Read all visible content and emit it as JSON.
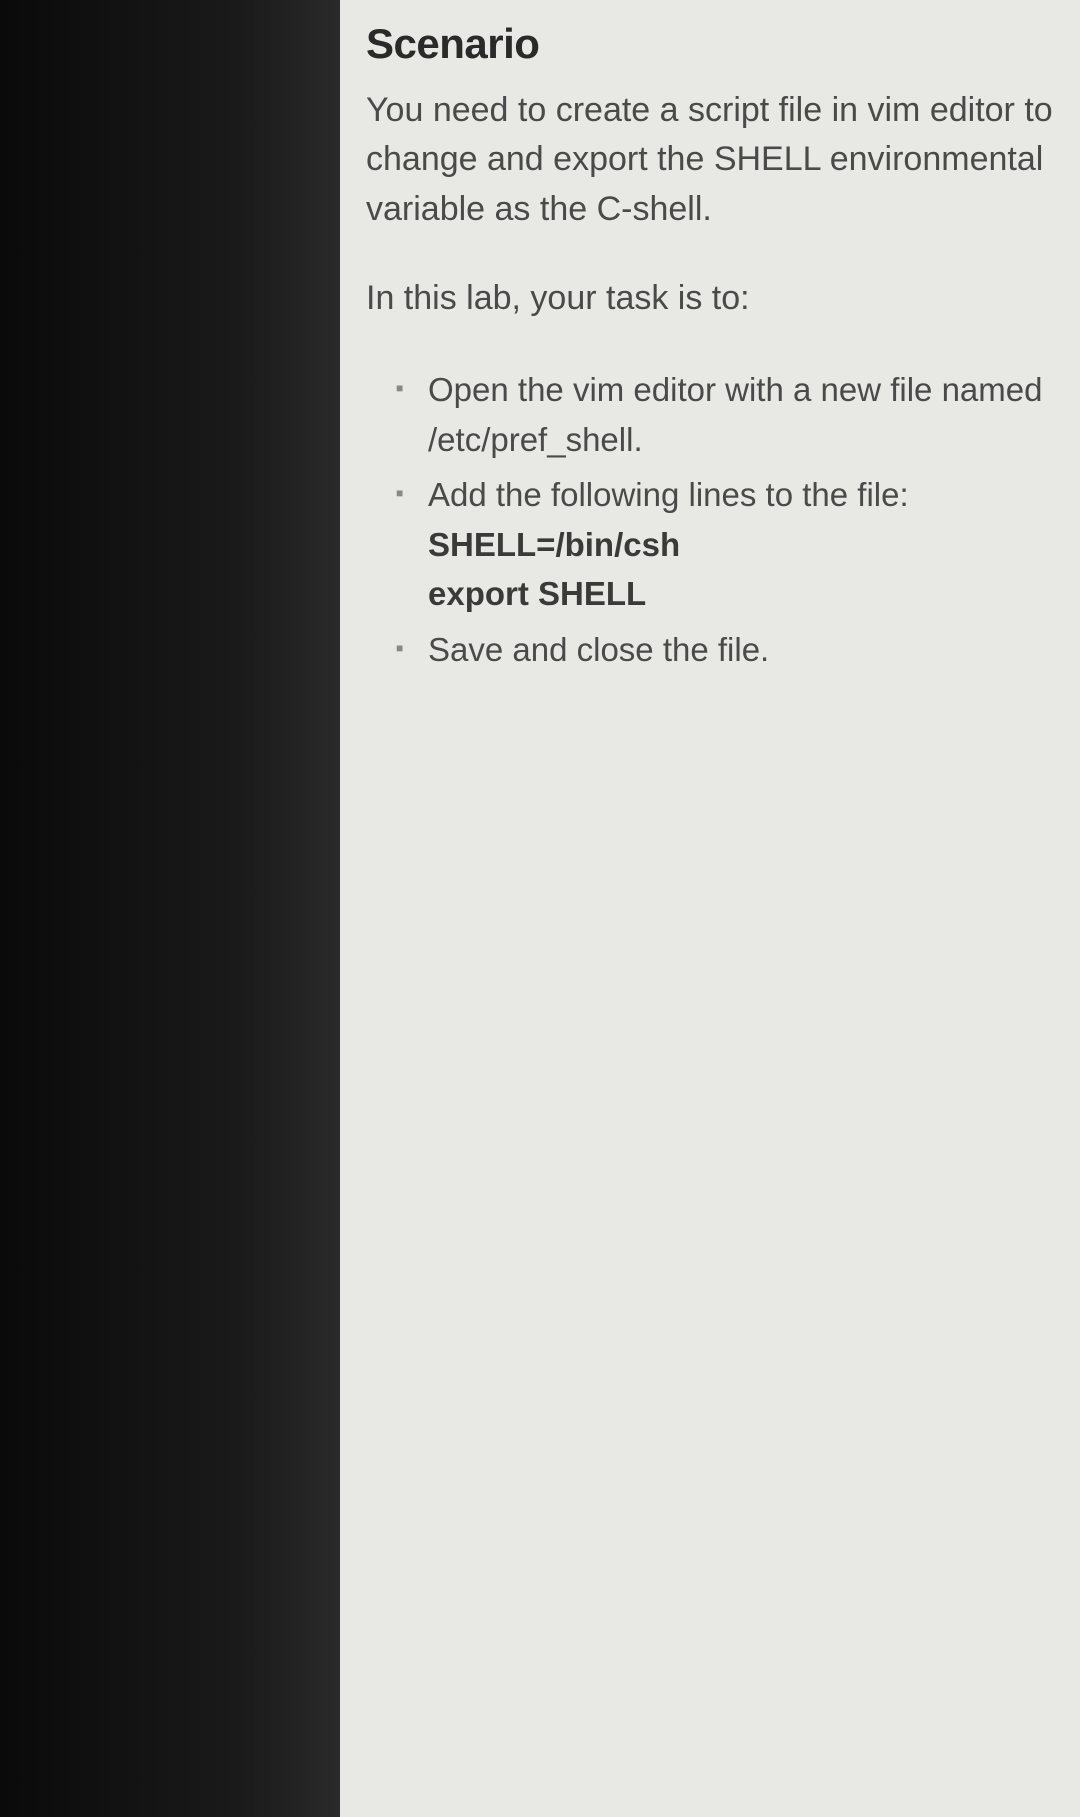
{
  "heading": "Scenario",
  "intro": "You need to create a script file in vim editor to change and export the SHELL environmental variable as the C-shell.",
  "task_prompt": "In this lab, your task is to:",
  "tasks": [
    {
      "text": "Open the vim editor with a new file named /etc/pref_shell."
    },
    {
      "text": "Add the following lines to the file:",
      "code1": "SHELL=/bin/csh",
      "code2": "export SHELL"
    },
    {
      "text": "Save and close the file."
    }
  ]
}
